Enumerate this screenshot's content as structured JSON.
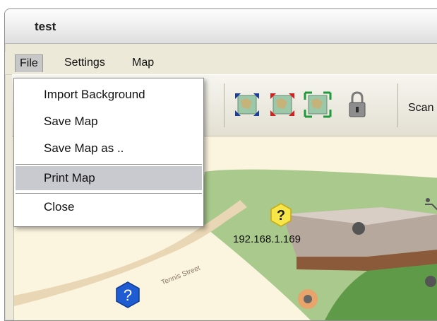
{
  "window": {
    "title": "test"
  },
  "menubar": {
    "items": [
      "File",
      "Settings",
      "Map"
    ]
  },
  "file_menu": {
    "items": [
      "Import Background",
      "Save Map",
      "Save Map as ..",
      "Print Map",
      "Close"
    ],
    "highlighted": "Print Map"
  },
  "toolbar": {
    "buttons": [
      "zoom-fit-blue-icon",
      "zoom-fit-red-icon",
      "zoom-fit-green-icon",
      "lock-icon"
    ],
    "scan_label": "Scan"
  },
  "map": {
    "nodes": [
      {
        "label": "192.168.1.169",
        "icon": "unknown-device-yellow-icon",
        "color": "#f6e64a"
      },
      {
        "label": "",
        "icon": "unknown-device-blue-icon",
        "color": "#1f5bd1"
      }
    ],
    "street_label": "Tennis Street"
  },
  "colors": {
    "highlight": "#c9c9d0",
    "window_bg": "#ece9d8",
    "map_bg": "#fbf4de"
  }
}
